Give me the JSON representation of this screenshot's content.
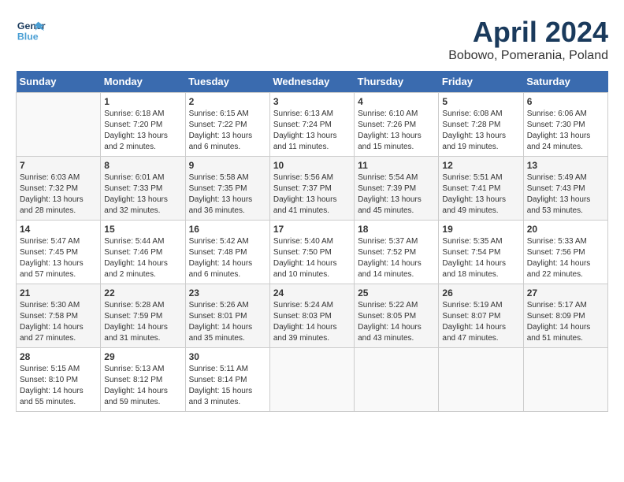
{
  "header": {
    "logo_line1": "General",
    "logo_line2": "Blue",
    "month": "April 2024",
    "location": "Bobowo, Pomerania, Poland"
  },
  "days_of_week": [
    "Sunday",
    "Monday",
    "Tuesday",
    "Wednesday",
    "Thursday",
    "Friday",
    "Saturday"
  ],
  "weeks": [
    [
      {
        "day": "",
        "sunrise": "",
        "sunset": "",
        "daylight": ""
      },
      {
        "day": "1",
        "sunrise": "Sunrise: 6:18 AM",
        "sunset": "Sunset: 7:20 PM",
        "daylight": "Daylight: 13 hours and 2 minutes."
      },
      {
        "day": "2",
        "sunrise": "Sunrise: 6:15 AM",
        "sunset": "Sunset: 7:22 PM",
        "daylight": "Daylight: 13 hours and 6 minutes."
      },
      {
        "day": "3",
        "sunrise": "Sunrise: 6:13 AM",
        "sunset": "Sunset: 7:24 PM",
        "daylight": "Daylight: 13 hours and 11 minutes."
      },
      {
        "day": "4",
        "sunrise": "Sunrise: 6:10 AM",
        "sunset": "Sunset: 7:26 PM",
        "daylight": "Daylight: 13 hours and 15 minutes."
      },
      {
        "day": "5",
        "sunrise": "Sunrise: 6:08 AM",
        "sunset": "Sunset: 7:28 PM",
        "daylight": "Daylight: 13 hours and 19 minutes."
      },
      {
        "day": "6",
        "sunrise": "Sunrise: 6:06 AM",
        "sunset": "Sunset: 7:30 PM",
        "daylight": "Daylight: 13 hours and 24 minutes."
      }
    ],
    [
      {
        "day": "7",
        "sunrise": "Sunrise: 6:03 AM",
        "sunset": "Sunset: 7:32 PM",
        "daylight": "Daylight: 13 hours and 28 minutes."
      },
      {
        "day": "8",
        "sunrise": "Sunrise: 6:01 AM",
        "sunset": "Sunset: 7:33 PM",
        "daylight": "Daylight: 13 hours and 32 minutes."
      },
      {
        "day": "9",
        "sunrise": "Sunrise: 5:58 AM",
        "sunset": "Sunset: 7:35 PM",
        "daylight": "Daylight: 13 hours and 36 minutes."
      },
      {
        "day": "10",
        "sunrise": "Sunrise: 5:56 AM",
        "sunset": "Sunset: 7:37 PM",
        "daylight": "Daylight: 13 hours and 41 minutes."
      },
      {
        "day": "11",
        "sunrise": "Sunrise: 5:54 AM",
        "sunset": "Sunset: 7:39 PM",
        "daylight": "Daylight: 13 hours and 45 minutes."
      },
      {
        "day": "12",
        "sunrise": "Sunrise: 5:51 AM",
        "sunset": "Sunset: 7:41 PM",
        "daylight": "Daylight: 13 hours and 49 minutes."
      },
      {
        "day": "13",
        "sunrise": "Sunrise: 5:49 AM",
        "sunset": "Sunset: 7:43 PM",
        "daylight": "Daylight: 13 hours and 53 minutes."
      }
    ],
    [
      {
        "day": "14",
        "sunrise": "Sunrise: 5:47 AM",
        "sunset": "Sunset: 7:45 PM",
        "daylight": "Daylight: 13 hours and 57 minutes."
      },
      {
        "day": "15",
        "sunrise": "Sunrise: 5:44 AM",
        "sunset": "Sunset: 7:46 PM",
        "daylight": "Daylight: 14 hours and 2 minutes."
      },
      {
        "day": "16",
        "sunrise": "Sunrise: 5:42 AM",
        "sunset": "Sunset: 7:48 PM",
        "daylight": "Daylight: 14 hours and 6 minutes."
      },
      {
        "day": "17",
        "sunrise": "Sunrise: 5:40 AM",
        "sunset": "Sunset: 7:50 PM",
        "daylight": "Daylight: 14 hours and 10 minutes."
      },
      {
        "day": "18",
        "sunrise": "Sunrise: 5:37 AM",
        "sunset": "Sunset: 7:52 PM",
        "daylight": "Daylight: 14 hours and 14 minutes."
      },
      {
        "day": "19",
        "sunrise": "Sunrise: 5:35 AM",
        "sunset": "Sunset: 7:54 PM",
        "daylight": "Daylight: 14 hours and 18 minutes."
      },
      {
        "day": "20",
        "sunrise": "Sunrise: 5:33 AM",
        "sunset": "Sunset: 7:56 PM",
        "daylight": "Daylight: 14 hours and 22 minutes."
      }
    ],
    [
      {
        "day": "21",
        "sunrise": "Sunrise: 5:30 AM",
        "sunset": "Sunset: 7:58 PM",
        "daylight": "Daylight: 14 hours and 27 minutes."
      },
      {
        "day": "22",
        "sunrise": "Sunrise: 5:28 AM",
        "sunset": "Sunset: 7:59 PM",
        "daylight": "Daylight: 14 hours and 31 minutes."
      },
      {
        "day": "23",
        "sunrise": "Sunrise: 5:26 AM",
        "sunset": "Sunset: 8:01 PM",
        "daylight": "Daylight: 14 hours and 35 minutes."
      },
      {
        "day": "24",
        "sunrise": "Sunrise: 5:24 AM",
        "sunset": "Sunset: 8:03 PM",
        "daylight": "Daylight: 14 hours and 39 minutes."
      },
      {
        "day": "25",
        "sunrise": "Sunrise: 5:22 AM",
        "sunset": "Sunset: 8:05 PM",
        "daylight": "Daylight: 14 hours and 43 minutes."
      },
      {
        "day": "26",
        "sunrise": "Sunrise: 5:19 AM",
        "sunset": "Sunset: 8:07 PM",
        "daylight": "Daylight: 14 hours and 47 minutes."
      },
      {
        "day": "27",
        "sunrise": "Sunrise: 5:17 AM",
        "sunset": "Sunset: 8:09 PM",
        "daylight": "Daylight: 14 hours and 51 minutes."
      }
    ],
    [
      {
        "day": "28",
        "sunrise": "Sunrise: 5:15 AM",
        "sunset": "Sunset: 8:10 PM",
        "daylight": "Daylight: 14 hours and 55 minutes."
      },
      {
        "day": "29",
        "sunrise": "Sunrise: 5:13 AM",
        "sunset": "Sunset: 8:12 PM",
        "daylight": "Daylight: 14 hours and 59 minutes."
      },
      {
        "day": "30",
        "sunrise": "Sunrise: 5:11 AM",
        "sunset": "Sunset: 8:14 PM",
        "daylight": "Daylight: 15 hours and 3 minutes."
      },
      {
        "day": "",
        "sunrise": "",
        "sunset": "",
        "daylight": ""
      },
      {
        "day": "",
        "sunrise": "",
        "sunset": "",
        "daylight": ""
      },
      {
        "day": "",
        "sunrise": "",
        "sunset": "",
        "daylight": ""
      },
      {
        "day": "",
        "sunrise": "",
        "sunset": "",
        "daylight": ""
      }
    ]
  ]
}
